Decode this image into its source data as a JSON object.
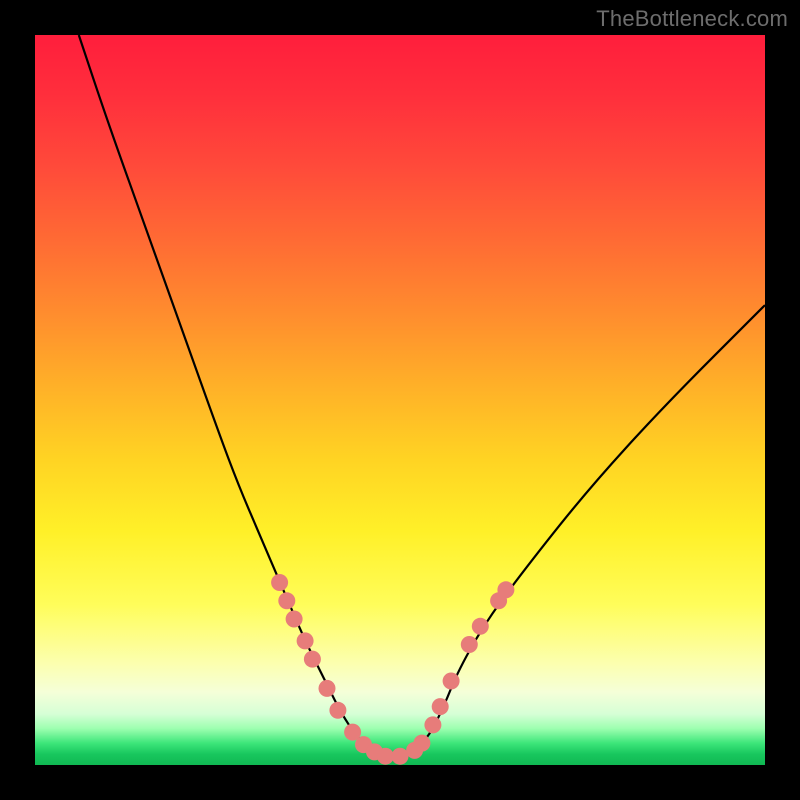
{
  "attribution": "TheBottleneck.com",
  "colors": {
    "page_bg": "#000000",
    "curve": "#000000",
    "dot_fill": "#e77c7a",
    "dot_stroke": "#a14c4a",
    "attribution_text": "#6d6d6d"
  },
  "chart_data": {
    "type": "line",
    "title": "",
    "xlabel": "",
    "ylabel": "",
    "xlim": [
      0,
      100
    ],
    "ylim": [
      0,
      100
    ],
    "grid": false,
    "legend": false,
    "notes": "V-shaped bottleneck curve on vertical red→orange→yellow→green gradient (green = low bottleneck at bottom). Y values = bottleneck % (height from bottom). X is an unlabeled relative scale. No axis ticks visible.",
    "series": [
      {
        "name": "bottleneck-curve",
        "x": [
          6,
          10,
          15,
          20,
          25,
          28,
          31,
          34,
          37,
          40,
          42,
          44,
          46,
          48,
          50,
          52,
          54,
          56,
          58,
          62,
          68,
          76,
          86,
          100
        ],
        "y": [
          100,
          88,
          74,
          60,
          46,
          38,
          31,
          24,
          17,
          11,
          7,
          4,
          2,
          1,
          1,
          2,
          4,
          8,
          13,
          20,
          28,
          38,
          49,
          63
        ]
      }
    ],
    "highlight_points": [
      {
        "x": 33.5,
        "y": 25.0
      },
      {
        "x": 34.5,
        "y": 22.5
      },
      {
        "x": 35.5,
        "y": 20.0
      },
      {
        "x": 37.0,
        "y": 17.0
      },
      {
        "x": 38.0,
        "y": 14.5
      },
      {
        "x": 40.0,
        "y": 10.5
      },
      {
        "x": 41.5,
        "y": 7.5
      },
      {
        "x": 43.5,
        "y": 4.5
      },
      {
        "x": 45.0,
        "y": 2.8
      },
      {
        "x": 46.5,
        "y": 1.8
      },
      {
        "x": 48.0,
        "y": 1.2
      },
      {
        "x": 50.0,
        "y": 1.2
      },
      {
        "x": 52.0,
        "y": 2.0
      },
      {
        "x": 53.0,
        "y": 3.0
      },
      {
        "x": 54.5,
        "y": 5.5
      },
      {
        "x": 55.5,
        "y": 8.0
      },
      {
        "x": 57.0,
        "y": 11.5
      },
      {
        "x": 59.5,
        "y": 16.5
      },
      {
        "x": 61.0,
        "y": 19.0
      },
      {
        "x": 63.5,
        "y": 22.5
      },
      {
        "x": 64.5,
        "y": 24.0
      }
    ]
  }
}
